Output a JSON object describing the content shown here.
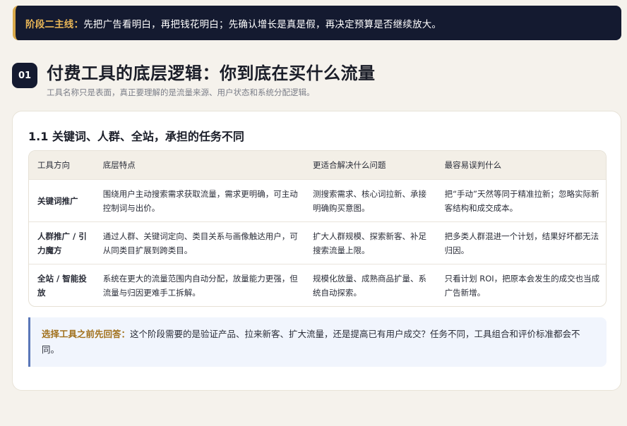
{
  "banner": {
    "lead": "阶段二主线：",
    "text": "先把广告看明白，再把钱花明白；先确认增长是真是假，再决定预算是否继续放大。"
  },
  "section": {
    "number": "01",
    "title": "付费工具的底层逻辑：你到底在买什么流量",
    "subtitle": "工具名称只是表面，真正要理解的是流量来源、用户状态和系统分配逻辑。"
  },
  "card": {
    "title": "1.1 关键词、人群、全站，承担的任务不同",
    "table": {
      "headers": [
        "工具方向",
        "底层特点",
        "更适合解决什么问题",
        "最容易误判什么"
      ],
      "rows": [
        {
          "tool": "关键词推广",
          "feature": "围绕用户主动搜索需求获取流量，需求更明确，可主动控制词与出价。",
          "solves": "测搜索需求、核心词拉新、承接明确购买意图。",
          "misjudge": "把“手动”天然等同于精准拉新；忽略实际新客结构和成交成本。"
        },
        {
          "tool": "人群推广 / 引力魔方",
          "feature": "通过人群、关键词定向、类目关系与画像触达用户，可从同类目扩展到跨类目。",
          "solves": "扩大人群规模、探索新客、补足搜索流量上限。",
          "misjudge": "把多类人群混进一个计划，结果好坏都无法归因。"
        },
        {
          "tool": "全站 / 智能投放",
          "feature": "系统在更大的流量范围内自动分配，放量能力更强，但流量与归因更难手工拆解。",
          "solves": "规模化放量、成熟商品扩量、系统自动探索。",
          "misjudge": "只看计划 ROI，把原本会发生的成交也当成广告新增。"
        }
      ]
    },
    "callout": {
      "lead": "选择工具之前先回答：",
      "text": "这个阶段需要的是验证产品、拉来新客、扩大流量，还是提高已有用户成交？任务不同，工具组合和评价标准都会不同。"
    }
  }
}
